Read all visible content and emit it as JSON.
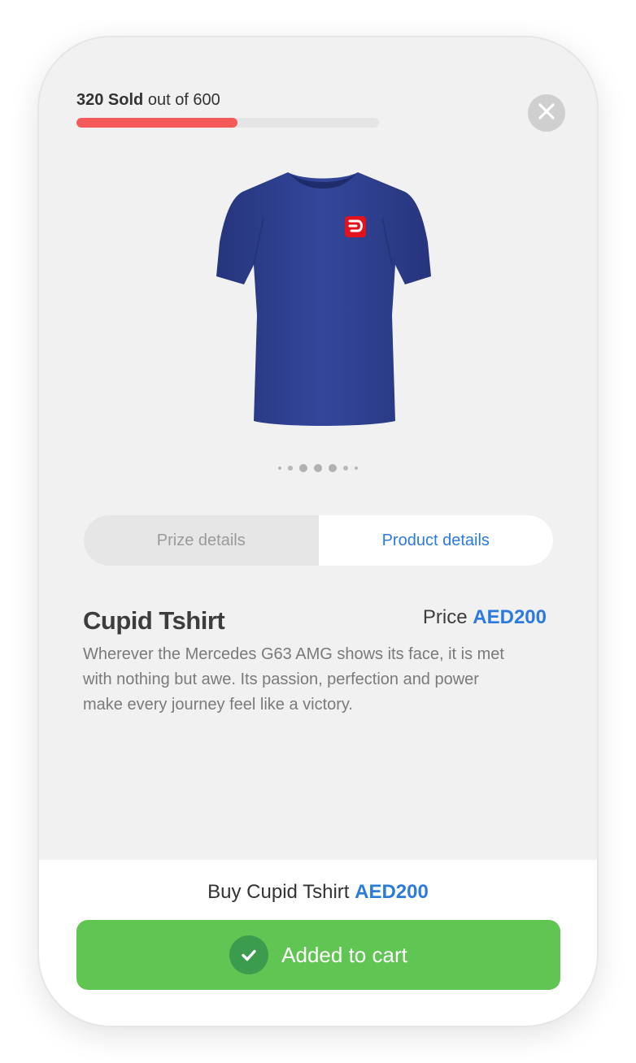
{
  "progress": {
    "sold_count": "320 Sold",
    "out_of_text": "out of 600",
    "sold_fraction": 0.533,
    "fill_color": "#f45a5a"
  },
  "icons": {
    "close": "close-icon",
    "check": "check-icon",
    "brand_logo": "brand-logo-icon"
  },
  "carousel": {
    "dot_count": 7,
    "active_indices": [
      2,
      3,
      4
    ]
  },
  "tabs": [
    {
      "label": "Prize details",
      "active": false
    },
    {
      "label": "Product details",
      "active": true
    }
  ],
  "product": {
    "title": "Cupid Tshirt",
    "price_label": "Price",
    "price_value": "AED200",
    "description": "Wherever the Mercedes G63 AMG shows its face, it is met with nothing but awe. Its passion, perfection and power make every journey feel like a victory."
  },
  "footer": {
    "buy_prefix": "Buy Cupid Tshirt",
    "buy_amount": "AED200",
    "cart_button_label": "Added to cart"
  },
  "colors": {
    "accent_blue": "#2b7bdf",
    "cart_green": "#61c553",
    "shirt_navy": "#2e3f8f",
    "logo_red": "#e1121b"
  }
}
